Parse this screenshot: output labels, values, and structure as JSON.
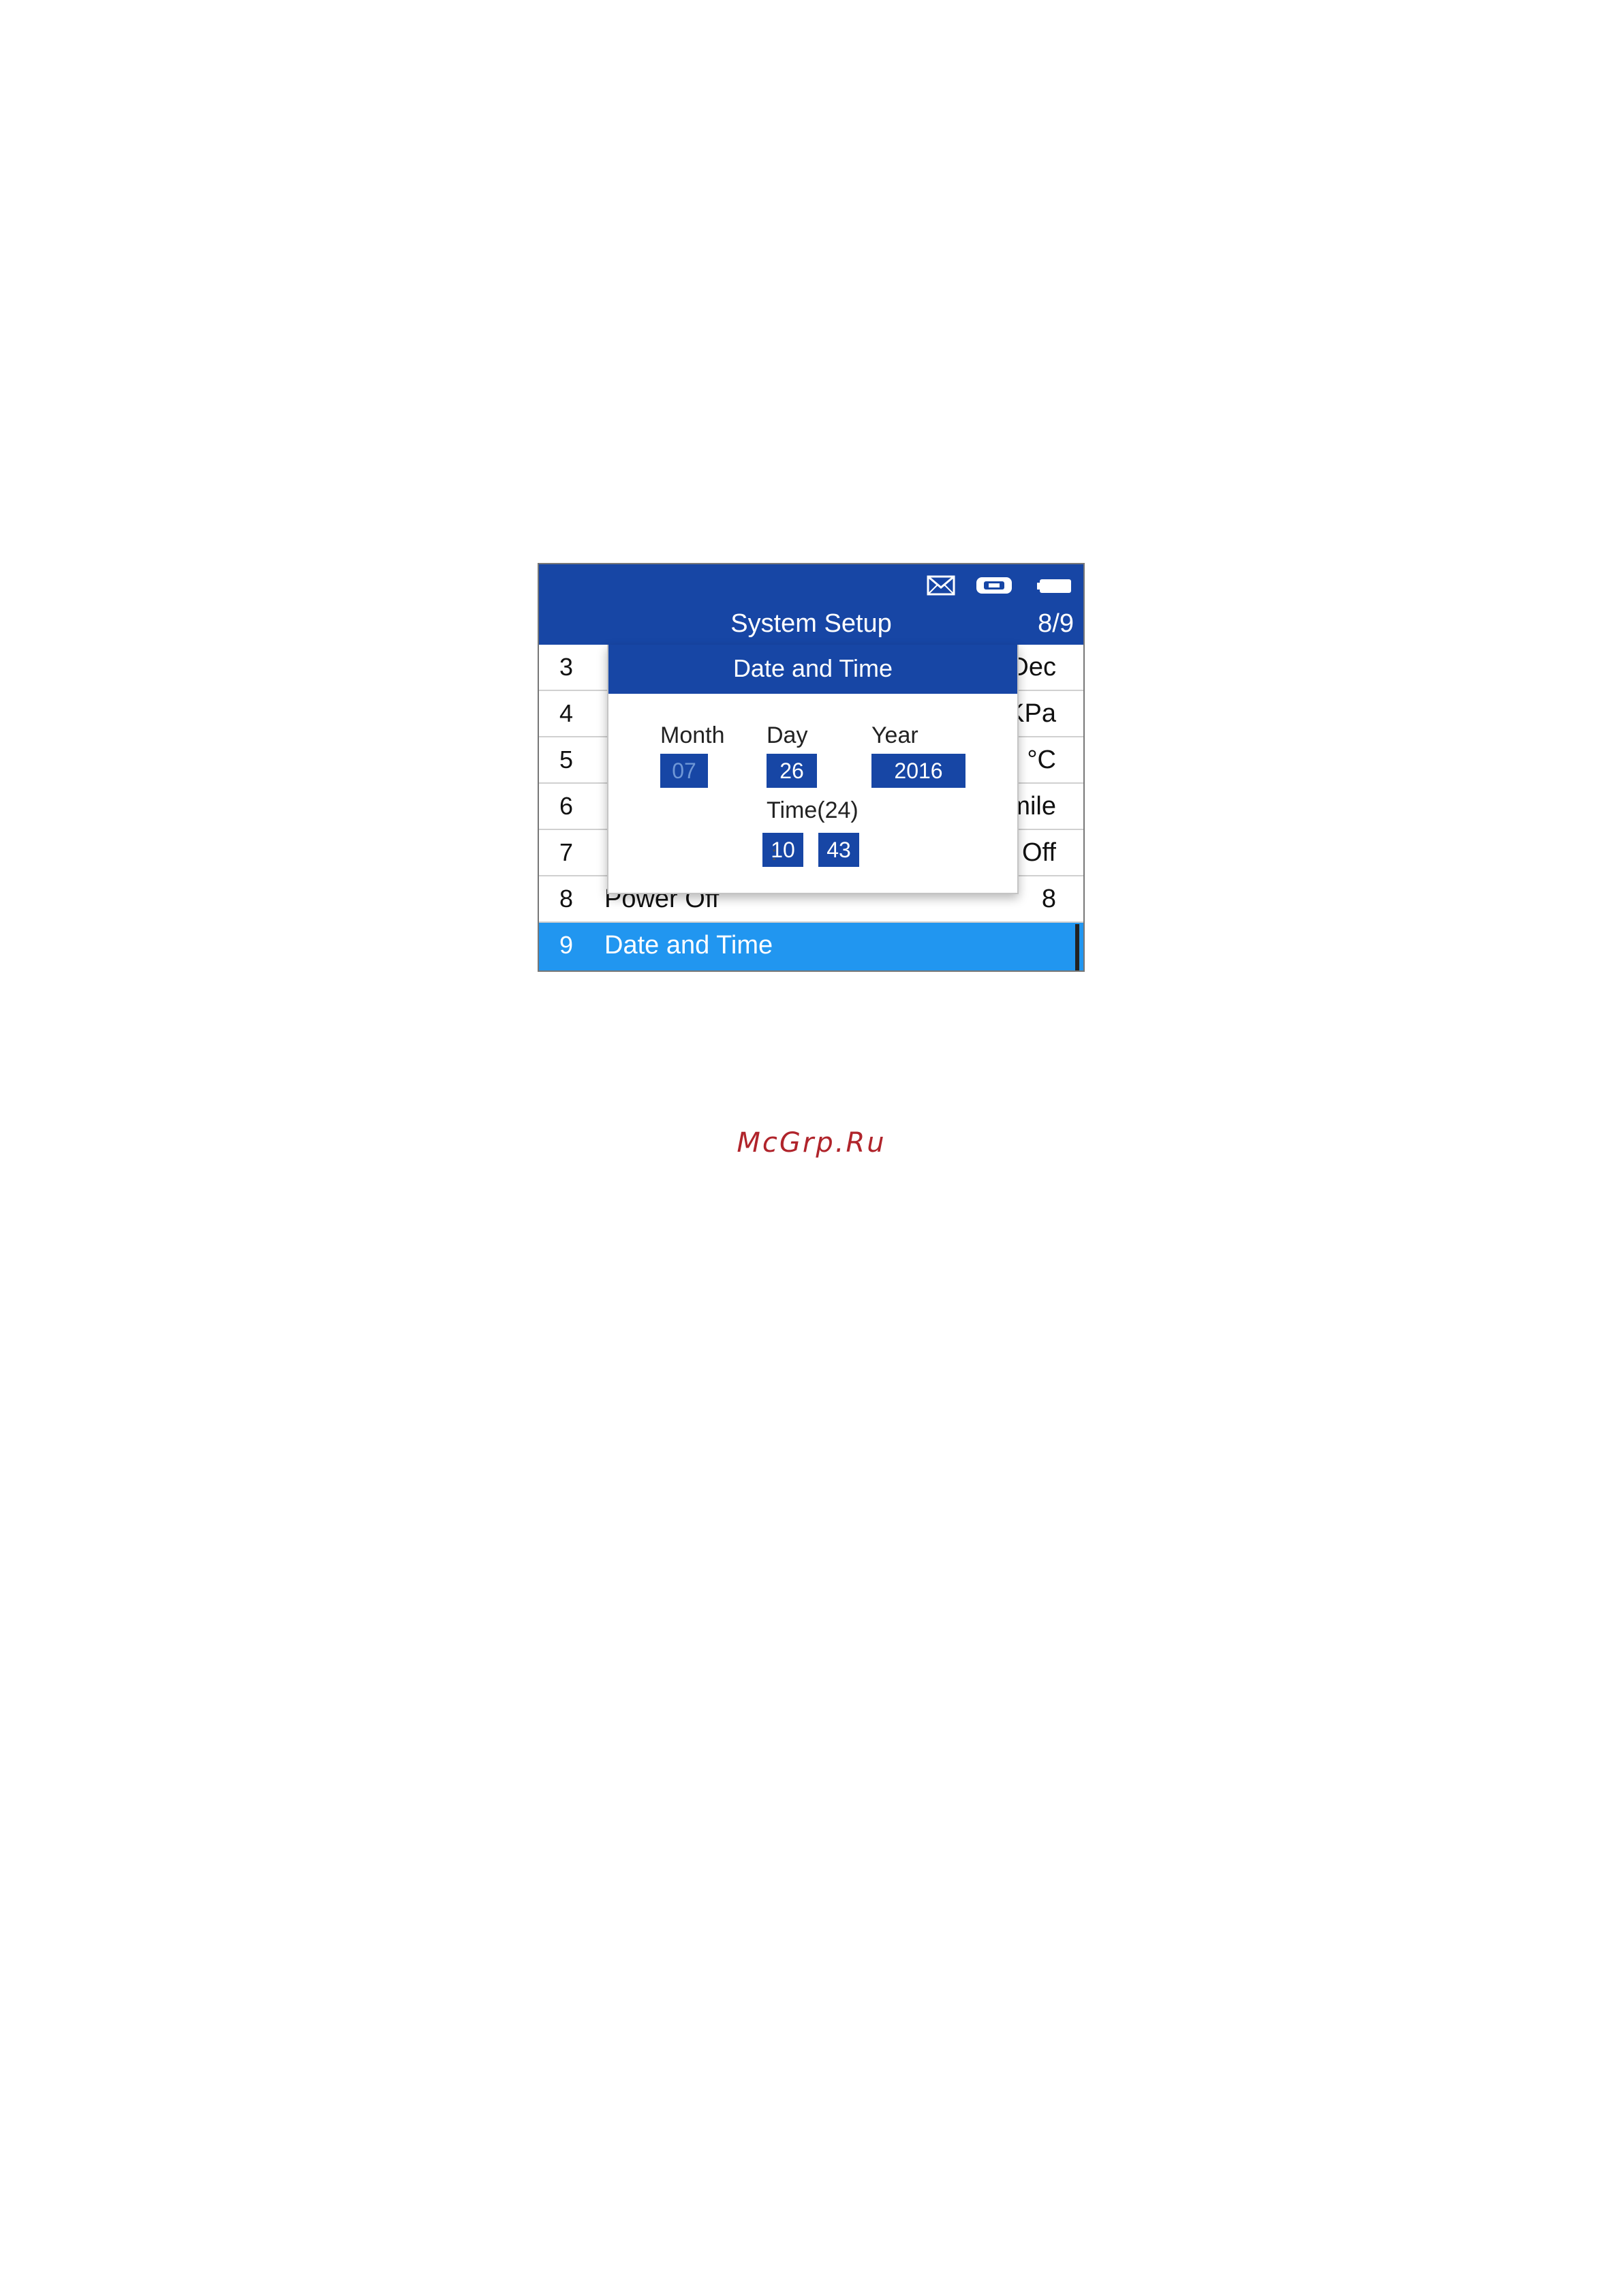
{
  "header": {
    "title": "System Setup",
    "page_count": "8/9"
  },
  "icons": [
    "mail-icon",
    "vci-icon",
    "battery-icon"
  ],
  "list": {
    "rows": [
      {
        "num": "3",
        "label": "",
        "value": "Dec"
      },
      {
        "num": "4",
        "label": "",
        "value": "KPa"
      },
      {
        "num": "5",
        "label": "",
        "value": "°C"
      },
      {
        "num": "6",
        "label": "",
        "value": "mile"
      },
      {
        "num": "7",
        "label": "",
        "value": "Off"
      },
      {
        "num": "8",
        "label": "Power Off",
        "value": "8"
      },
      {
        "num": "9",
        "label": "Date and Time",
        "value": ""
      }
    ]
  },
  "dialog": {
    "title": "Date and Time",
    "month_label": "Month",
    "month_value": "07",
    "day_label": "Day",
    "day_value": "26",
    "year_label": "Year",
    "year_value": "2016",
    "time_label": "Time(24)",
    "hour_value": "10",
    "time_separator": ":",
    "minute_value": "43"
  },
  "watermark": "McGrp.Ru",
  "colors": {
    "header_blue": "#1746a5",
    "selected_row": "#2196f0",
    "watermark": "#b0242b"
  }
}
